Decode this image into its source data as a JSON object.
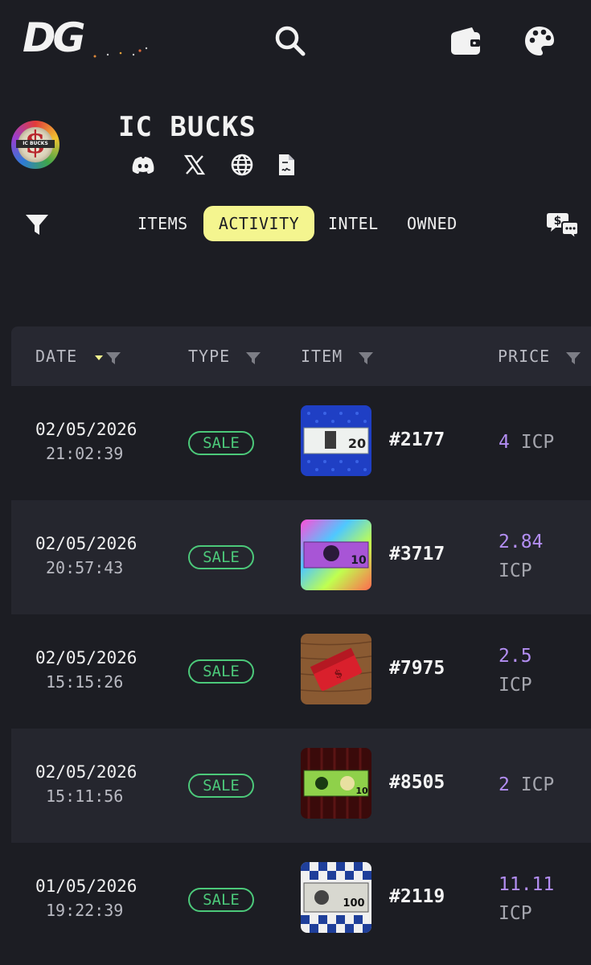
{
  "nav": {
    "logo": "DG"
  },
  "collection": {
    "title": "IC BUCKS",
    "avatar_text": "IC BUCKS"
  },
  "tabs": {
    "items": "ITEMS",
    "activity": "ACTIVITY",
    "intel": "INTEL",
    "owned": "OWNED",
    "active": "ACTIVITY"
  },
  "table": {
    "headers": {
      "date": "DATE",
      "type": "TYPE",
      "item": "ITEM",
      "price": "PRICE"
    },
    "rows": [
      {
        "date": "02/05/2026",
        "time": "21:02:39",
        "type": "SALE",
        "item": "#2177",
        "price": "4",
        "unit": "ICP"
      },
      {
        "date": "02/05/2026",
        "time": "20:57:43",
        "type": "SALE",
        "item": "#3717",
        "price": "2.84",
        "unit": "ICP"
      },
      {
        "date": "02/05/2026",
        "time": "15:15:26",
        "type": "SALE",
        "item": "#7975",
        "price": "2.5",
        "unit": "ICP"
      },
      {
        "date": "02/05/2026",
        "time": "15:11:56",
        "type": "SALE",
        "item": "#8505",
        "price": "2",
        "unit": "ICP"
      },
      {
        "date": "01/05/2026",
        "time": "19:22:39",
        "type": "SALE",
        "item": "#2119",
        "price": "11.11",
        "unit": "ICP"
      }
    ]
  },
  "colors": {
    "background": "#1c1d23",
    "active_tab": "#f4f58f",
    "sale_green": "#4cc97a",
    "price_purple": "#b38ef3",
    "sort_indicator": "#f4f58f"
  }
}
